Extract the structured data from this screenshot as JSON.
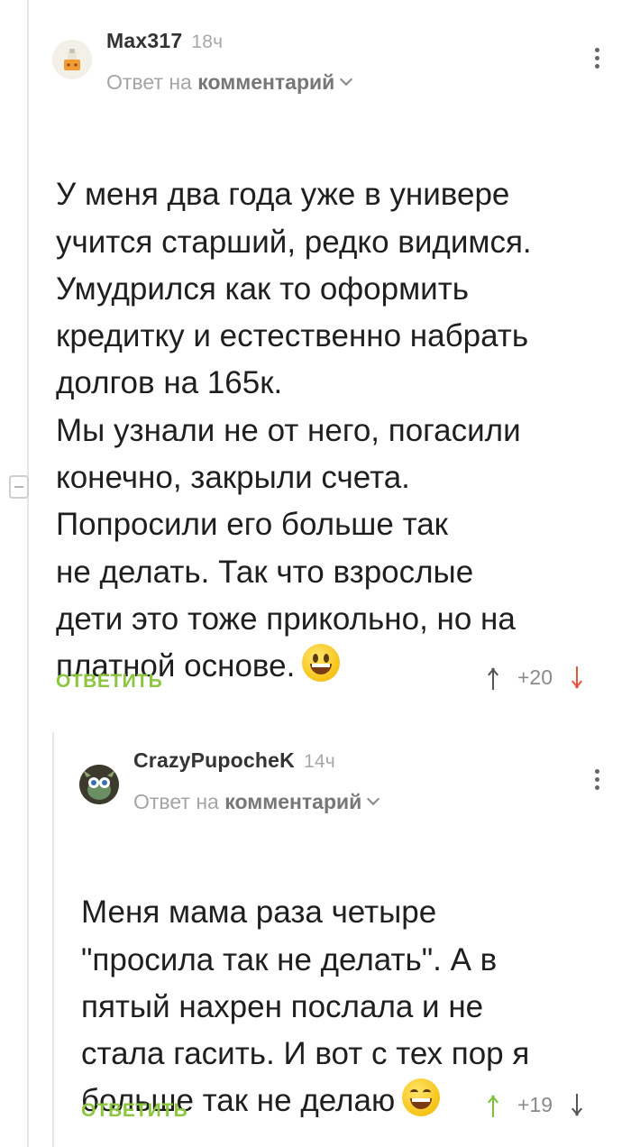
{
  "comments": [
    {
      "author": "Max317",
      "time": "18ч",
      "reply_prefix": "Ответ на",
      "reply_target": "комментарий",
      "text": "У меня два года уже в универе\nучится старший, редко видимся.\nУмудрился как то оформить\nкредитку и естественно набрать\nдолгов на 165к.\nМы узнали не от него, погасили\nконечно, закрыли счета.\nПопросили его больше так\nне делать. Так что взрослые\nдети это тоже прикольно, но на\nплатной основе.",
      "emoji": "grinning-face",
      "reply_label": "ОТВЕТИТЬ",
      "rating": "+20"
    },
    {
      "author": "CrazyPupocheK",
      "time": "14ч",
      "reply_prefix": "Ответ на",
      "reply_target": "комментарий",
      "text": "Меня мама раза четыре\n\"просила так не делать\". А в\nпятый нахрен послала и не\nстала гасить. И вот с тех пор я\nбольше так не делаю",
      "emoji": "grinning-squinting-face",
      "reply_label": "ОТВЕТИТЬ",
      "rating": "+19"
    }
  ],
  "colors": {
    "accent_green": "#8cc63f",
    "downvote_red": "#e8533a",
    "upvote_green": "#7cc13a",
    "muted_text": "#a5a5a5"
  }
}
